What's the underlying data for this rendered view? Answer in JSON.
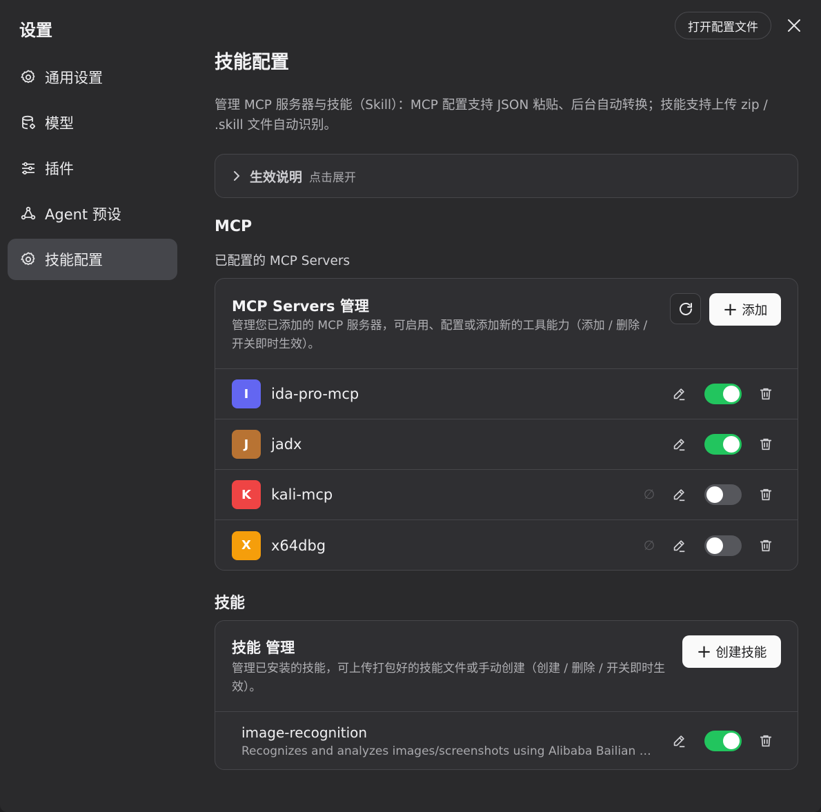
{
  "app": {
    "title": "设置"
  },
  "header": {
    "open_config_label": "打开配置文件"
  },
  "sidebar": {
    "items": [
      {
        "label": "通用设置",
        "icon": "gear-icon",
        "active": false
      },
      {
        "label": "模型",
        "icon": "database-icon",
        "active": false
      },
      {
        "label": "插件",
        "icon": "sliders-icon",
        "active": false
      },
      {
        "label": "Agent 预设",
        "icon": "agent-icon",
        "active": false
      },
      {
        "label": "技能配置",
        "icon": "gear-icon",
        "active": true
      }
    ]
  },
  "main": {
    "title": "技能配置",
    "description": "管理 MCP 服务器与技能（Skill）：MCP 配置支持 JSON 粘贴、后台自动转换；技能支持上传 zip / .skill 文件自动识别。",
    "collapse": {
      "title": "生效说明",
      "hint": "点击展开"
    },
    "mcp_section": {
      "heading": "MCP",
      "subheading": "已配置的 MCP Servers",
      "card_title": "MCP Servers 管理",
      "card_desc": "管理您已添加的 MCP 服务器，可启用、配置或添加新的工具能力（添加 / 删除 / 开关即时生效）。",
      "add_label": "添加",
      "servers": [
        {
          "initial": "I",
          "name": "ida-pro-mcp",
          "color": "#6366f1",
          "enabled": true,
          "null_marker": false
        },
        {
          "initial": "J",
          "name": "jadx",
          "color": "#b87333",
          "enabled": true,
          "null_marker": false
        },
        {
          "initial": "K",
          "name": "kali-mcp",
          "color": "#ef4444",
          "enabled": false,
          "null_marker": true
        },
        {
          "initial": "X",
          "name": "x64dbg",
          "color": "#f59e0b",
          "enabled": false,
          "null_marker": true
        }
      ]
    },
    "skills_section": {
      "heading": "技能",
      "card_title": "技能 管理",
      "card_desc": "管理已安装的技能，可上传打包好的技能文件或手动创建（创建 / 删除 / 开关即时生效）。",
      "create_label": "创建技能",
      "skills": [
        {
          "name": "image-recognition",
          "description": "Recognizes and analyzes images/screenshots using Alibaba Bailian Qwen ...",
          "enabled": true
        }
      ]
    }
  },
  "colors": {
    "accent_on": "#22c55e",
    "toggle_off": "#56575c",
    "active_nav": "#45464b"
  },
  "null_symbol": "∅"
}
